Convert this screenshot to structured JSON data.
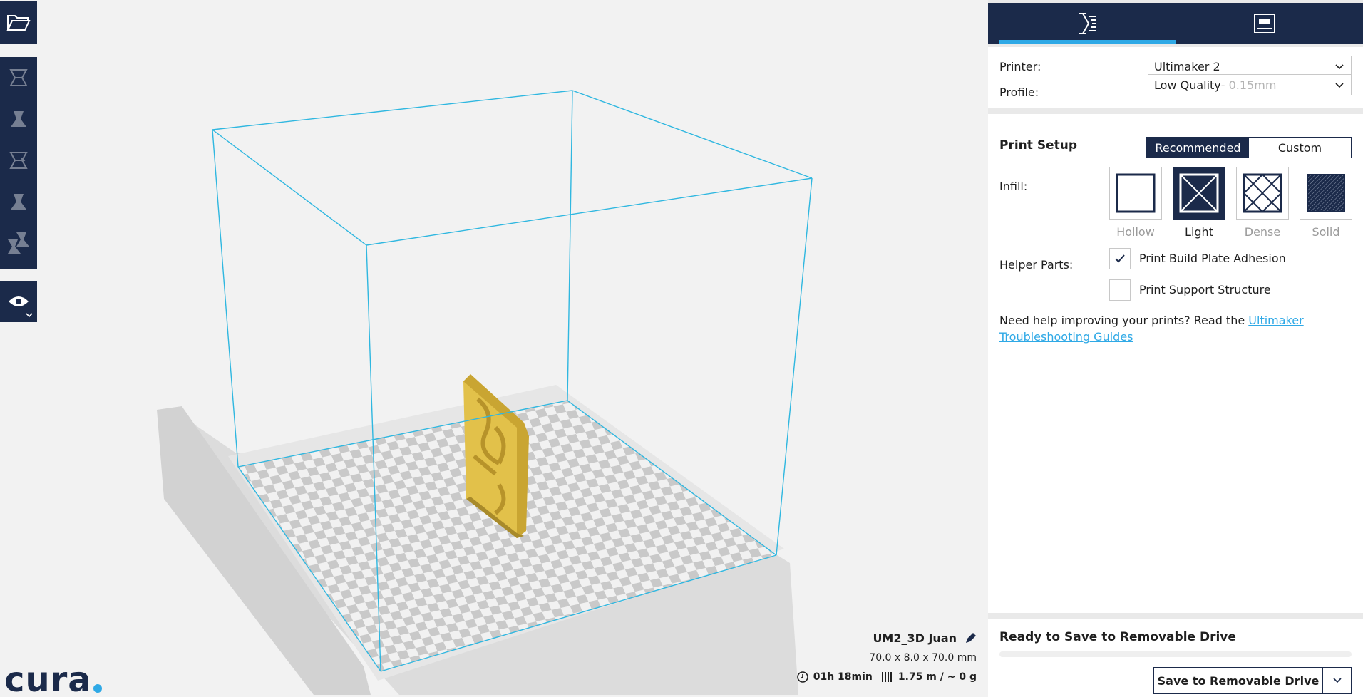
{
  "brand": {
    "logo_text": "cura",
    "accent": "#2fa9e6",
    "primary": "#1b2a4a"
  },
  "toolbar": {
    "icons": [
      "open-file-icon",
      "translate-tool-icon",
      "scale-tool-icon",
      "rotate-tool-icon",
      "mirror-tool-icon",
      "per-object-settings-icon",
      "view-mode-icon"
    ]
  },
  "sidebar": {
    "tabs": [
      {
        "icon": "print-setup-icon",
        "active": true
      },
      {
        "icon": "monitor-icon",
        "active": false
      }
    ],
    "printer_label": "Printer:",
    "printer_value": "Ultimaker 2",
    "profile_label": "Profile:",
    "profile_value": "Low Quality",
    "profile_suffix": " - 0.15mm",
    "print_setup_title": "Print Setup",
    "mode_recommended": "Recommended",
    "mode_custom": "Custom",
    "infill_label": "Infill:",
    "infill_options": [
      {
        "label": "Hollow",
        "selected": false
      },
      {
        "label": "Light",
        "selected": true
      },
      {
        "label": "Dense",
        "selected": false
      },
      {
        "label": "Solid",
        "selected": false
      }
    ],
    "helper_parts_label": "Helper Parts:",
    "adhesion_label": "Print Build Plate Adhesion",
    "adhesion_checked": true,
    "support_label": "Print Support Structure",
    "support_checked": false,
    "help_text": "Need help improving your prints? Read the ",
    "help_link": "Ultimaker Troubleshooting Guides",
    "status_title": "Ready to Save to Removable Drive",
    "progress": 0,
    "save_button": "Save to Removable Drive"
  },
  "job": {
    "name": "UM2_3D Juan",
    "dimensions": "70.0 x 8.0 x 70.0 mm",
    "time": "01h 18min",
    "material": "1.75 m / ~ 0 g"
  }
}
